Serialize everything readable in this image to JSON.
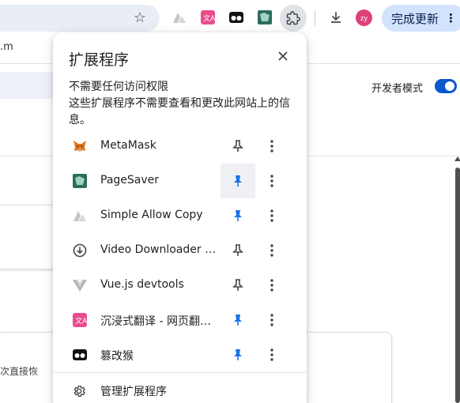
{
  "toolbar": {
    "avatar_initials": "zy",
    "update_button_label": "完成更新",
    "update_button_more": "⋮"
  },
  "background_page": {
    "tab_text": ".m",
    "dev_mode_label": "开发者模式",
    "dev_mode_enabled": true,
    "card_snippet": "次直接恢"
  },
  "popup": {
    "title": "扩展程序",
    "section_title": "不需要任何访问权限",
    "section_description": "这些扩展程序不需要查看和更改此网站上的信息。",
    "extensions": [
      {
        "name": "MetaMask",
        "icon": "metamask-fox-icon",
        "pinned": false
      },
      {
        "name": "PageSaver",
        "icon": "pagesaver-icon",
        "pinned": true
      },
      {
        "name": "Simple Allow Copy",
        "icon": "simple-allow-copy-icon",
        "pinned": true
      },
      {
        "name": "Video Downloader professional",
        "icon": "video-downloader-icon",
        "pinned": false
      },
      {
        "name": "Vue.js devtools",
        "icon": "vue-icon",
        "pinned": false
      },
      {
        "name": "沉浸式翻译 - 网页翻译插件",
        "icon": "immersive-translate-icon",
        "pinned": true
      },
      {
        "name": "篡改猴",
        "icon": "tampermonkey-icon",
        "pinned": true
      }
    ],
    "manage_label": "管理扩展程序"
  },
  "colors": {
    "pinned_blue": "#1a73e8",
    "toggle_blue": "#0b57d0",
    "update_button_bg": "#d3e3fd"
  }
}
